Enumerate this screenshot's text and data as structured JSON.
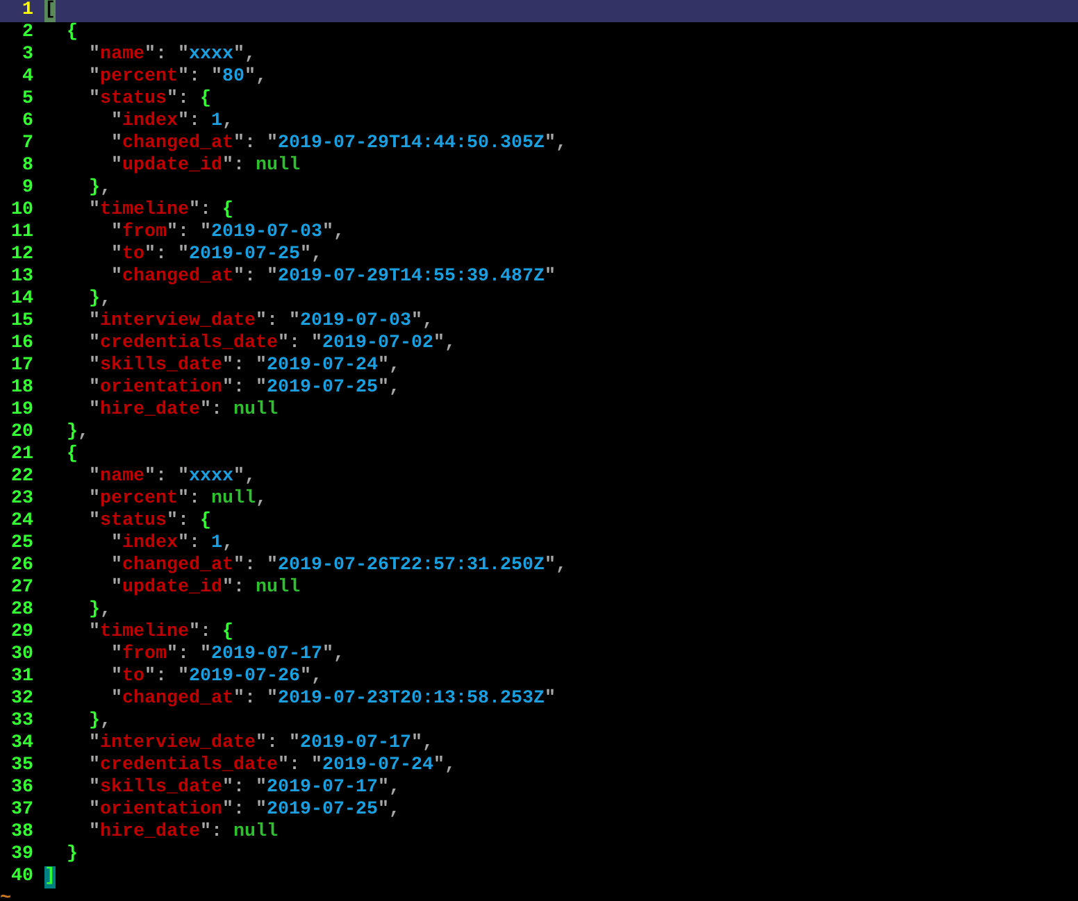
{
  "lines": [
    {
      "number": "1",
      "current": true,
      "tokens": [
        {
          "kind": "cursor",
          "text": "["
        }
      ]
    },
    {
      "number": "2",
      "current": false,
      "tokens": [
        {
          "kind": "brace",
          "text": "  {"
        }
      ]
    },
    {
      "number": "3",
      "current": false,
      "tokens": [
        {
          "kind": "punct",
          "text": "    \""
        },
        {
          "kind": "key",
          "text": "name"
        },
        {
          "kind": "punct",
          "text": "\": \""
        },
        {
          "kind": "string",
          "text": "xxxx"
        },
        {
          "kind": "punct",
          "text": "\","
        }
      ]
    },
    {
      "number": "4",
      "current": false,
      "tokens": [
        {
          "kind": "punct",
          "text": "    \""
        },
        {
          "kind": "key",
          "text": "percent"
        },
        {
          "kind": "punct",
          "text": "\": \""
        },
        {
          "kind": "string",
          "text": "80"
        },
        {
          "kind": "punct",
          "text": "\","
        }
      ]
    },
    {
      "number": "5",
      "current": false,
      "tokens": [
        {
          "kind": "punct",
          "text": "    \""
        },
        {
          "kind": "key",
          "text": "status"
        },
        {
          "kind": "punct",
          "text": "\": "
        },
        {
          "kind": "brace",
          "text": "{"
        }
      ]
    },
    {
      "number": "6",
      "current": false,
      "tokens": [
        {
          "kind": "punct",
          "text": "      \""
        },
        {
          "kind": "key",
          "text": "index"
        },
        {
          "kind": "punct",
          "text": "\": "
        },
        {
          "kind": "number",
          "text": "1"
        },
        {
          "kind": "punct",
          "text": ","
        }
      ]
    },
    {
      "number": "7",
      "current": false,
      "tokens": [
        {
          "kind": "punct",
          "text": "      \""
        },
        {
          "kind": "key",
          "text": "changed_at"
        },
        {
          "kind": "punct",
          "text": "\": \""
        },
        {
          "kind": "string",
          "text": "2019-07-29T14:44:50.305Z"
        },
        {
          "kind": "punct",
          "text": "\","
        }
      ]
    },
    {
      "number": "8",
      "current": false,
      "tokens": [
        {
          "kind": "punct",
          "text": "      \""
        },
        {
          "kind": "key",
          "text": "update_id"
        },
        {
          "kind": "punct",
          "text": "\": "
        },
        {
          "kind": "null",
          "text": "null"
        }
      ]
    },
    {
      "number": "9",
      "current": false,
      "tokens": [
        {
          "kind": "brace",
          "text": "    }"
        },
        {
          "kind": "punct",
          "text": ","
        }
      ]
    },
    {
      "number": "10",
      "current": false,
      "tokens": [
        {
          "kind": "punct",
          "text": "    \""
        },
        {
          "kind": "key",
          "text": "timeline"
        },
        {
          "kind": "punct",
          "text": "\": "
        },
        {
          "kind": "brace",
          "text": "{"
        }
      ]
    },
    {
      "number": "11",
      "current": false,
      "tokens": [
        {
          "kind": "punct",
          "text": "      \""
        },
        {
          "kind": "key",
          "text": "from"
        },
        {
          "kind": "punct",
          "text": "\": \""
        },
        {
          "kind": "string",
          "text": "2019-07-03"
        },
        {
          "kind": "punct",
          "text": "\","
        }
      ]
    },
    {
      "number": "12",
      "current": false,
      "tokens": [
        {
          "kind": "punct",
          "text": "      \""
        },
        {
          "kind": "key",
          "text": "to"
        },
        {
          "kind": "punct",
          "text": "\": \""
        },
        {
          "kind": "string",
          "text": "2019-07-25"
        },
        {
          "kind": "punct",
          "text": "\","
        }
      ]
    },
    {
      "number": "13",
      "current": false,
      "tokens": [
        {
          "kind": "punct",
          "text": "      \""
        },
        {
          "kind": "key",
          "text": "changed_at"
        },
        {
          "kind": "punct",
          "text": "\": \""
        },
        {
          "kind": "string",
          "text": "2019-07-29T14:55:39.487Z"
        },
        {
          "kind": "punct",
          "text": "\""
        }
      ]
    },
    {
      "number": "14",
      "current": false,
      "tokens": [
        {
          "kind": "brace",
          "text": "    }"
        },
        {
          "kind": "punct",
          "text": ","
        }
      ]
    },
    {
      "number": "15",
      "current": false,
      "tokens": [
        {
          "kind": "punct",
          "text": "    \""
        },
        {
          "kind": "key",
          "text": "interview_date"
        },
        {
          "kind": "punct",
          "text": "\": \""
        },
        {
          "kind": "string",
          "text": "2019-07-03"
        },
        {
          "kind": "punct",
          "text": "\","
        }
      ]
    },
    {
      "number": "16",
      "current": false,
      "tokens": [
        {
          "kind": "punct",
          "text": "    \""
        },
        {
          "kind": "key",
          "text": "credentials_date"
        },
        {
          "kind": "punct",
          "text": "\": \""
        },
        {
          "kind": "string",
          "text": "2019-07-02"
        },
        {
          "kind": "punct",
          "text": "\","
        }
      ]
    },
    {
      "number": "17",
      "current": false,
      "tokens": [
        {
          "kind": "punct",
          "text": "    \""
        },
        {
          "kind": "key",
          "text": "skills_date"
        },
        {
          "kind": "punct",
          "text": "\": \""
        },
        {
          "kind": "string",
          "text": "2019-07-24"
        },
        {
          "kind": "punct",
          "text": "\","
        }
      ]
    },
    {
      "number": "18",
      "current": false,
      "tokens": [
        {
          "kind": "punct",
          "text": "    \""
        },
        {
          "kind": "key",
          "text": "orientation"
        },
        {
          "kind": "punct",
          "text": "\": \""
        },
        {
          "kind": "string",
          "text": "2019-07-25"
        },
        {
          "kind": "punct",
          "text": "\","
        }
      ]
    },
    {
      "number": "19",
      "current": false,
      "tokens": [
        {
          "kind": "punct",
          "text": "    \""
        },
        {
          "kind": "key",
          "text": "hire_date"
        },
        {
          "kind": "punct",
          "text": "\": "
        },
        {
          "kind": "null",
          "text": "null"
        }
      ]
    },
    {
      "number": "20",
      "current": false,
      "tokens": [
        {
          "kind": "brace",
          "text": "  }"
        },
        {
          "kind": "punct",
          "text": ","
        }
      ]
    },
    {
      "number": "21",
      "current": false,
      "tokens": [
        {
          "kind": "brace",
          "text": "  {"
        }
      ]
    },
    {
      "number": "22",
      "current": false,
      "tokens": [
        {
          "kind": "punct",
          "text": "    \""
        },
        {
          "kind": "key",
          "text": "name"
        },
        {
          "kind": "punct",
          "text": "\": \""
        },
        {
          "kind": "string",
          "text": "xxxx"
        },
        {
          "kind": "punct",
          "text": "\","
        }
      ]
    },
    {
      "number": "23",
      "current": false,
      "tokens": [
        {
          "kind": "punct",
          "text": "    \""
        },
        {
          "kind": "key",
          "text": "percent"
        },
        {
          "kind": "punct",
          "text": "\": "
        },
        {
          "kind": "null",
          "text": "null"
        },
        {
          "kind": "punct",
          "text": ","
        }
      ]
    },
    {
      "number": "24",
      "current": false,
      "tokens": [
        {
          "kind": "punct",
          "text": "    \""
        },
        {
          "kind": "key",
          "text": "status"
        },
        {
          "kind": "punct",
          "text": "\": "
        },
        {
          "kind": "brace",
          "text": "{"
        }
      ]
    },
    {
      "number": "25",
      "current": false,
      "tokens": [
        {
          "kind": "punct",
          "text": "      \""
        },
        {
          "kind": "key",
          "text": "index"
        },
        {
          "kind": "punct",
          "text": "\": "
        },
        {
          "kind": "number",
          "text": "1"
        },
        {
          "kind": "punct",
          "text": ","
        }
      ]
    },
    {
      "number": "26",
      "current": false,
      "tokens": [
        {
          "kind": "punct",
          "text": "      \""
        },
        {
          "kind": "key",
          "text": "changed_at"
        },
        {
          "kind": "punct",
          "text": "\": \""
        },
        {
          "kind": "string",
          "text": "2019-07-26T22:57:31.250Z"
        },
        {
          "kind": "punct",
          "text": "\","
        }
      ]
    },
    {
      "number": "27",
      "current": false,
      "tokens": [
        {
          "kind": "punct",
          "text": "      \""
        },
        {
          "kind": "key",
          "text": "update_id"
        },
        {
          "kind": "punct",
          "text": "\": "
        },
        {
          "kind": "null",
          "text": "null"
        }
      ]
    },
    {
      "number": "28",
      "current": false,
      "tokens": [
        {
          "kind": "brace",
          "text": "    }"
        },
        {
          "kind": "punct",
          "text": ","
        }
      ]
    },
    {
      "number": "29",
      "current": false,
      "tokens": [
        {
          "kind": "punct",
          "text": "    \""
        },
        {
          "kind": "key",
          "text": "timeline"
        },
        {
          "kind": "punct",
          "text": "\": "
        },
        {
          "kind": "brace",
          "text": "{"
        }
      ]
    },
    {
      "number": "30",
      "current": false,
      "tokens": [
        {
          "kind": "punct",
          "text": "      \""
        },
        {
          "kind": "key",
          "text": "from"
        },
        {
          "kind": "punct",
          "text": "\": \""
        },
        {
          "kind": "string",
          "text": "2019-07-17"
        },
        {
          "kind": "punct",
          "text": "\","
        }
      ]
    },
    {
      "number": "31",
      "current": false,
      "tokens": [
        {
          "kind": "punct",
          "text": "      \""
        },
        {
          "kind": "key",
          "text": "to"
        },
        {
          "kind": "punct",
          "text": "\": \""
        },
        {
          "kind": "string",
          "text": "2019-07-26"
        },
        {
          "kind": "punct",
          "text": "\","
        }
      ]
    },
    {
      "number": "32",
      "current": false,
      "tokens": [
        {
          "kind": "punct",
          "text": "      \""
        },
        {
          "kind": "key",
          "text": "changed_at"
        },
        {
          "kind": "punct",
          "text": "\": \""
        },
        {
          "kind": "string",
          "text": "2019-07-23T20:13:58.253Z"
        },
        {
          "kind": "punct",
          "text": "\""
        }
      ]
    },
    {
      "number": "33",
      "current": false,
      "tokens": [
        {
          "kind": "brace",
          "text": "    }"
        },
        {
          "kind": "punct",
          "text": ","
        }
      ]
    },
    {
      "number": "34",
      "current": false,
      "tokens": [
        {
          "kind": "punct",
          "text": "    \""
        },
        {
          "kind": "key",
          "text": "interview_date"
        },
        {
          "kind": "punct",
          "text": "\": \""
        },
        {
          "kind": "string",
          "text": "2019-07-17"
        },
        {
          "kind": "punct",
          "text": "\","
        }
      ]
    },
    {
      "number": "35",
      "current": false,
      "tokens": [
        {
          "kind": "punct",
          "text": "    \""
        },
        {
          "kind": "key",
          "text": "credentials_date"
        },
        {
          "kind": "punct",
          "text": "\": \""
        },
        {
          "kind": "string",
          "text": "2019-07-24"
        },
        {
          "kind": "punct",
          "text": "\","
        }
      ]
    },
    {
      "number": "36",
      "current": false,
      "tokens": [
        {
          "kind": "punct",
          "text": "    \""
        },
        {
          "kind": "key",
          "text": "skills_date"
        },
        {
          "kind": "punct",
          "text": "\": \""
        },
        {
          "kind": "string",
          "text": "2019-07-17"
        },
        {
          "kind": "punct",
          "text": "\","
        }
      ]
    },
    {
      "number": "37",
      "current": false,
      "tokens": [
        {
          "kind": "punct",
          "text": "    \""
        },
        {
          "kind": "key",
          "text": "orientation"
        },
        {
          "kind": "punct",
          "text": "\": \""
        },
        {
          "kind": "string",
          "text": "2019-07-25"
        },
        {
          "kind": "punct",
          "text": "\","
        }
      ]
    },
    {
      "number": "38",
      "current": false,
      "tokens": [
        {
          "kind": "punct",
          "text": "    \""
        },
        {
          "kind": "key",
          "text": "hire_date"
        },
        {
          "kind": "punct",
          "text": "\": "
        },
        {
          "kind": "null",
          "text": "null"
        }
      ]
    },
    {
      "number": "39",
      "current": false,
      "tokens": [
        {
          "kind": "brace",
          "text": "  }"
        }
      ]
    },
    {
      "number": "40",
      "current": false,
      "tokens": [
        {
          "kind": "match",
          "text": "]"
        }
      ]
    }
  ],
  "filler": [
    "~"
  ]
}
